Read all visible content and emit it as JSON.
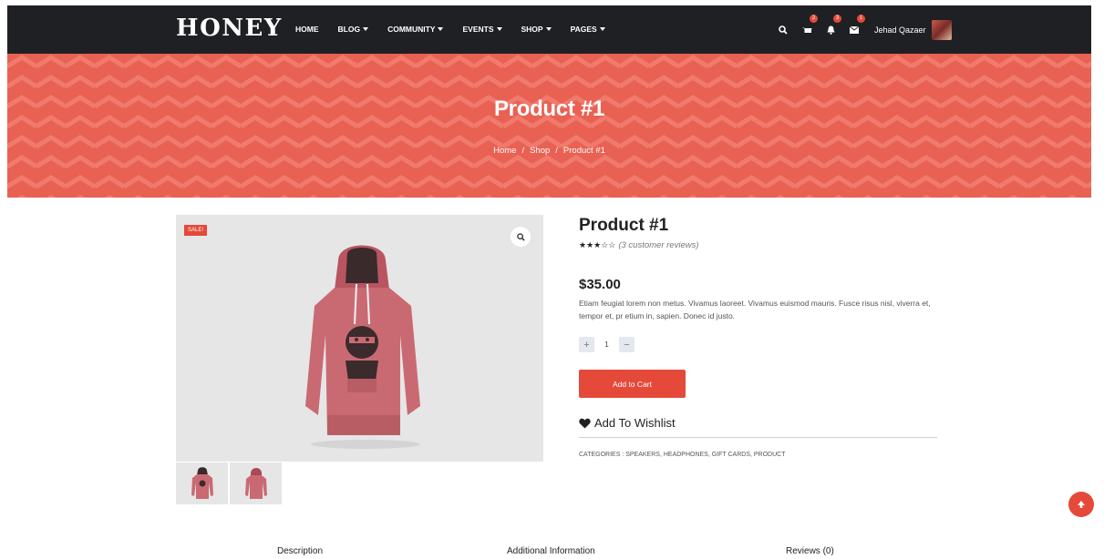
{
  "brand": {
    "logo": "HONEY",
    "accent": "#e5493a",
    "nav_bg": "#1f2023",
    "hero_bg": "#e86153"
  },
  "nav": {
    "items": [
      {
        "label": "HOME",
        "dropdown": false
      },
      {
        "label": "BLOG",
        "dropdown": true
      },
      {
        "label": "COMMUNITY",
        "dropdown": true
      },
      {
        "label": "EVENTS",
        "dropdown": true
      },
      {
        "label": "SHOP",
        "dropdown": true
      },
      {
        "label": "PAGES",
        "dropdown": true
      }
    ],
    "icons": [
      "search-icon",
      "cart-icon",
      "bell-icon",
      "envelope-icon"
    ],
    "badges": {
      "cart": "2",
      "notifications": "3",
      "messages": "1"
    },
    "user_name": "Jehad Qazaer"
  },
  "hero": {
    "title": "Product #1",
    "breadcrumb": [
      "Home",
      "Shop",
      "Product #1"
    ],
    "separator": "/"
  },
  "product": {
    "sale_label": "SALE!",
    "name": "Product #1",
    "rating": {
      "stars_filled": 3,
      "stars_total": 5,
      "reviews_text": "(3 customer reviews)"
    },
    "price": "$35.00",
    "description": "Etiam feugiat lorem non metus. Vivamus laoreet. Vivamus euismod mauris. Fusce risus nisl, viverra et, tempor et, pr etium in, sapien. Donec id justo.",
    "quantity": "1",
    "qty_plus": "+",
    "qty_minus": "−",
    "add_to_cart": "Add to Cart",
    "wishlist": "Add To Wishlist",
    "categories": "CATEGORIES : SPEAKERS, HEADPHONES, GIFT CARDS, PRODUCT"
  },
  "tabs": [
    "Description",
    "Additional Information",
    "Reviews (0)"
  ]
}
